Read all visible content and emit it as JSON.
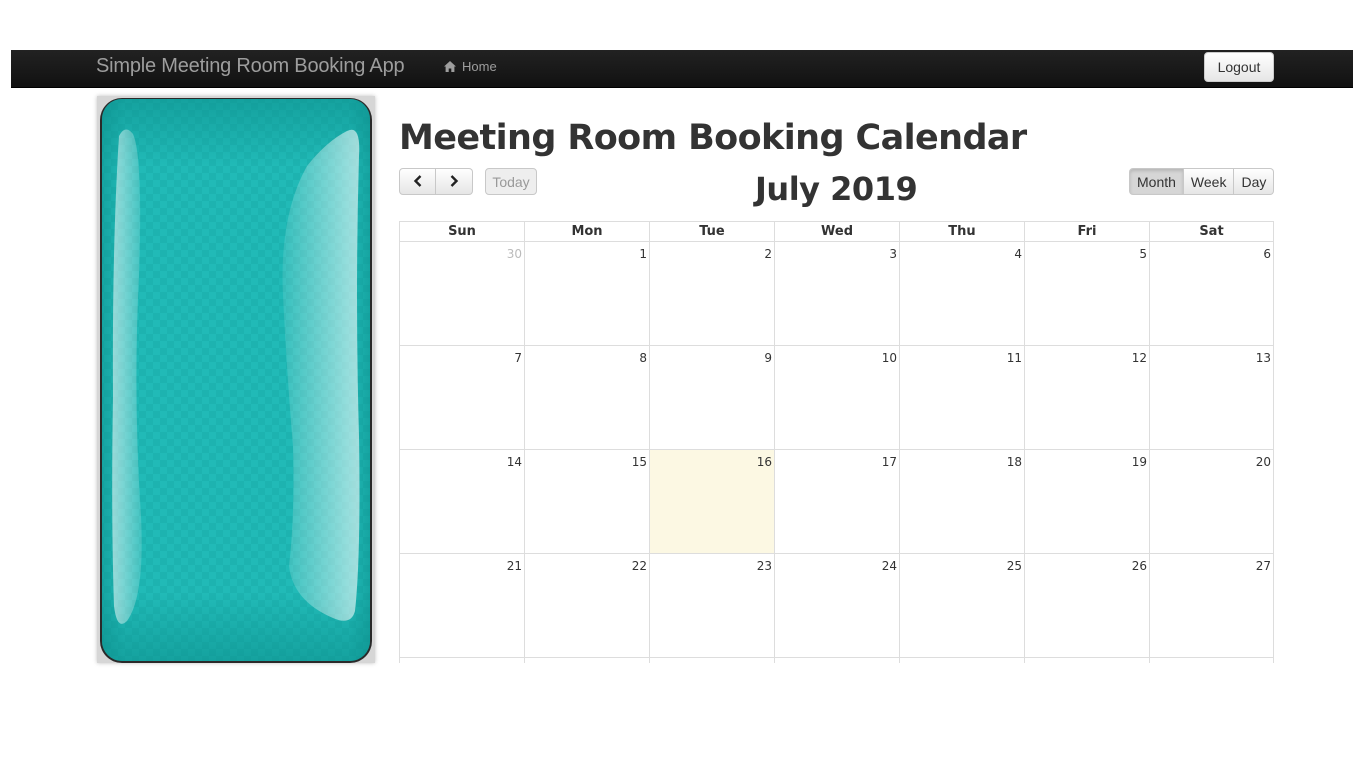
{
  "navbar": {
    "brand": "Simple Meeting Room Booking App",
    "home_label": "Home",
    "home_icon": "home-icon",
    "logout_label": "Logout"
  },
  "calendar": {
    "title": "Meeting Room Booking Calendar",
    "month_label": "July 2019",
    "prev_icon": "chevron-left-icon",
    "next_icon": "chevron-right-icon",
    "today_label": "Today",
    "views": [
      {
        "label": "Month",
        "active": true
      },
      {
        "label": "Week",
        "active": false
      },
      {
        "label": "Day",
        "active": false
      }
    ],
    "weekdays": [
      "Sun",
      "Mon",
      "Tue",
      "Wed",
      "Thu",
      "Fri",
      "Sat"
    ],
    "weeks": [
      [
        {
          "day": "30",
          "other": true
        },
        {
          "day": "1"
        },
        {
          "day": "2"
        },
        {
          "day": "3"
        },
        {
          "day": "4"
        },
        {
          "day": "5"
        },
        {
          "day": "6"
        }
      ],
      [
        {
          "day": "7"
        },
        {
          "day": "8"
        },
        {
          "day": "9"
        },
        {
          "day": "10"
        },
        {
          "day": "11"
        },
        {
          "day": "12"
        },
        {
          "day": "13"
        }
      ],
      [
        {
          "day": "14"
        },
        {
          "day": "15"
        },
        {
          "day": "16",
          "today": true
        },
        {
          "day": "17"
        },
        {
          "day": "18"
        },
        {
          "day": "19"
        },
        {
          "day": "20"
        }
      ],
      [
        {
          "day": "21"
        },
        {
          "day": "22"
        },
        {
          "day": "23"
        },
        {
          "day": "24"
        },
        {
          "day": "25"
        },
        {
          "day": "26"
        },
        {
          "day": "27"
        }
      ],
      [
        {
          "day": ""
        },
        {
          "day": ""
        },
        {
          "day": ""
        },
        {
          "day": ""
        },
        {
          "day": ""
        },
        {
          "day": ""
        },
        {
          "day": ""
        }
      ]
    ],
    "colors": {
      "today_bg": "#fcf8e3",
      "grid_border": "#dddddd"
    }
  },
  "side_panel": {
    "image": "teal-glossy-panel",
    "colors": {
      "base": "#1eb5b2",
      "dark": "#0f8f8c"
    }
  }
}
